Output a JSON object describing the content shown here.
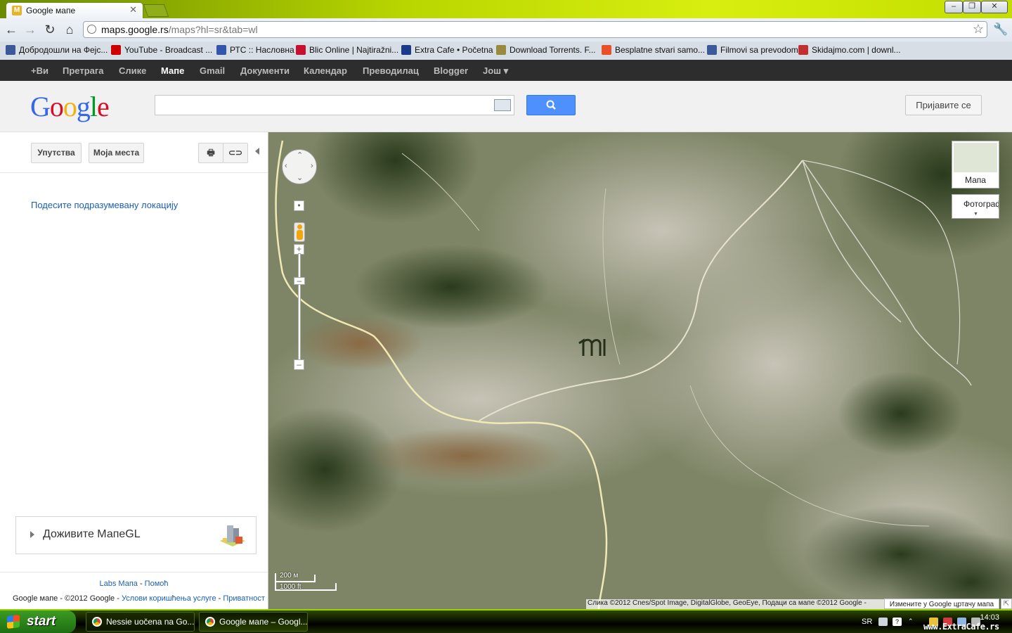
{
  "browser": {
    "tab_title": "Google мапе",
    "url_host": "maps.google.rs",
    "url_path": "/maps?hl=sr&tab=wl"
  },
  "bookmarks": [
    {
      "label": "Добродошли на Фејс...",
      "color": "#3b5998"
    },
    {
      "label": "YouTube - Broadcast ...",
      "color": "#cc0000"
    },
    {
      "label": "РТС :: Насловна",
      "color": "#3355aa"
    },
    {
      "label": "Blic Online | Najtiražni...",
      "color": "#c8102e"
    },
    {
      "label": "Extra Cafe • Početna",
      "color": "#1a3a8a"
    },
    {
      "label": "Download Torrents. F...",
      "color": "#9a8a40"
    },
    {
      "label": "Besplatne stvari samo...",
      "color": "#e8502a"
    },
    {
      "label": "Filmovi sa prevodom",
      "color": "#3a5a9a"
    },
    {
      "label": "Skidajmo.com | downl...",
      "color": "#c03030"
    }
  ],
  "gbar": {
    "items": [
      "+Ви",
      "Претрага",
      "Слике",
      "Мапе",
      "Gmail",
      "Документи",
      "Календар",
      "Преводилац",
      "Blogger",
      "Још ▾"
    ],
    "selected": "Мапе"
  },
  "header": {
    "logo": "Google",
    "search_placeholder": "",
    "signin_label": "Пријавите се"
  },
  "panel": {
    "directions_label": "Упутства",
    "myplaces_label": "Моја места",
    "default_location_link": "Подесите подразумевану локацију",
    "mapsgl_label": "Доживите МапеGL",
    "labs_link": "Labs Мапа",
    "help_link": "Помоћ",
    "copyright": "Google мапе - ©2012 Google - ",
    "terms_link": "Услови коришћења услуге",
    "privacy_link": "Приватност"
  },
  "map": {
    "maptype_map": "Мапа",
    "maptype_sat": "Фотографија",
    "scale_metric": "200 м",
    "scale_imperial": "1000 ft",
    "attribution": "Слика ©2012 Cnes/Spot Image, DigitalGlobe, GeoEye, Подаци са мапе ©2012 Google -",
    "report_label": "Измените у Google цртачу мапа"
  },
  "taskbar": {
    "start_label": "start",
    "tasks": [
      "Nessie uočena na Go...",
      "Google мапе – Googl..."
    ],
    "lang": "SR",
    "clock": "14:03",
    "watermark": "www.ExtraCafe.rs"
  }
}
